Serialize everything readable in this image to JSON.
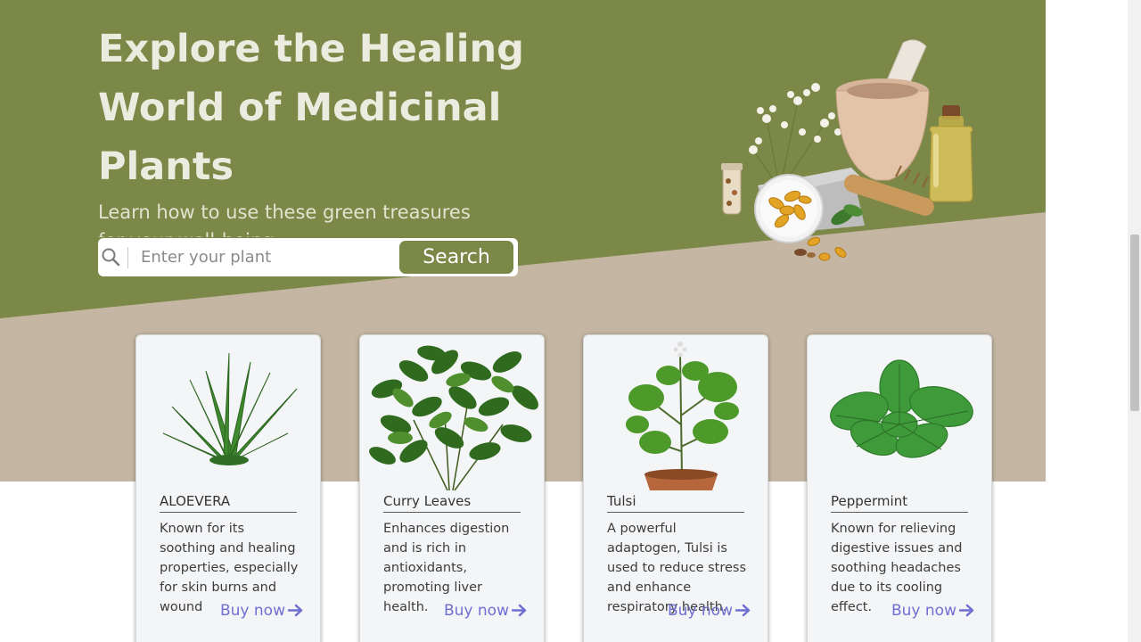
{
  "hero": {
    "title": "Explore the Healing World of Medicinal Plants",
    "subtitle": "Learn how to use these green treasures for your well-being",
    "green": "#7b8847",
    "tan": "#c4b6a2"
  },
  "search": {
    "placeholder": "Enter your plant",
    "button_label": "Search",
    "icon": "search-icon"
  },
  "cards": [
    {
      "title": "ALOEVERA",
      "description": "Known for its soothing and healing properties, especially for skin burns and wound",
      "buy_label": "Buy now",
      "image": "aloe-vera-image"
    },
    {
      "title": "Curry Leaves",
      "description": "Enhances digestion and is rich in antioxidants, promoting liver health.",
      "buy_label": "Buy now",
      "image": "curry-leaves-image"
    },
    {
      "title": "Tulsi",
      "description": "A powerful adaptogen, Tulsi is used to reduce stress and enhance respiratory health.",
      "buy_label": "Buy now",
      "image": "tulsi-image"
    },
    {
      "title": "Peppermint",
      "description": "Known for relieving digestive issues and soothing headaches due to its cooling effect.",
      "buy_label": "Buy now",
      "image": "peppermint-image"
    }
  ],
  "accent": {
    "link": "#6f6fd2"
  }
}
